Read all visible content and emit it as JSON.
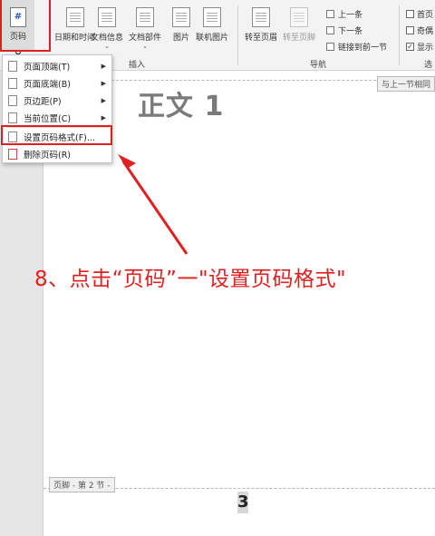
{
  "ribbon": {
    "page_number_button": "页码",
    "buttons": [
      {
        "label": "日期和时间",
        "icon": "calendar-icon"
      },
      {
        "label": "文档信息",
        "icon": "document-info-icon"
      },
      {
        "label": "文档部件",
        "icon": "quick-parts-icon"
      },
      {
        "label": "图片",
        "icon": "picture-icon"
      },
      {
        "label": "联机图片",
        "icon": "online-picture-icon"
      }
    ],
    "insert_group_label": "插入",
    "navigation": {
      "goto_header": "转至页眉",
      "goto_footer": "转至页脚",
      "previous": "上一条",
      "next": "下一条",
      "link_previous": "链接到前一节",
      "group_label": "导航"
    },
    "options": [
      {
        "label": "首页",
        "checked": false
      },
      {
        "label": "奇偶",
        "checked": false
      },
      {
        "label": "显示",
        "checked": true
      }
    ],
    "options_group_label": "选"
  },
  "menu": {
    "items": [
      {
        "label": "页面顶端(T)",
        "has_submenu": true,
        "icon": "page-top-icon"
      },
      {
        "label": "页面底端(B)",
        "has_submenu": true,
        "icon": "page-bottom-icon"
      },
      {
        "label": "页边距(P)",
        "has_submenu": true,
        "icon": "page-margin-icon"
      },
      {
        "label": "当前位置(C)",
        "has_submenu": true,
        "icon": "current-position-icon"
      },
      {
        "label": "设置页码格式(F)...",
        "has_submenu": false,
        "icon": "format-page-number-icon"
      },
      {
        "label": "删除页码(R)",
        "has_submenu": false,
        "icon": "remove-page-number-icon"
      }
    ]
  },
  "document": {
    "same_as_previous": "与上一节相同",
    "body_title": "正文 1",
    "footer_label": "页脚 - 第 2 节 -",
    "page_number": "3"
  },
  "annotation": {
    "text": "8、点击“页码”一\"设置页码格式\"",
    "color": "#e02020"
  }
}
